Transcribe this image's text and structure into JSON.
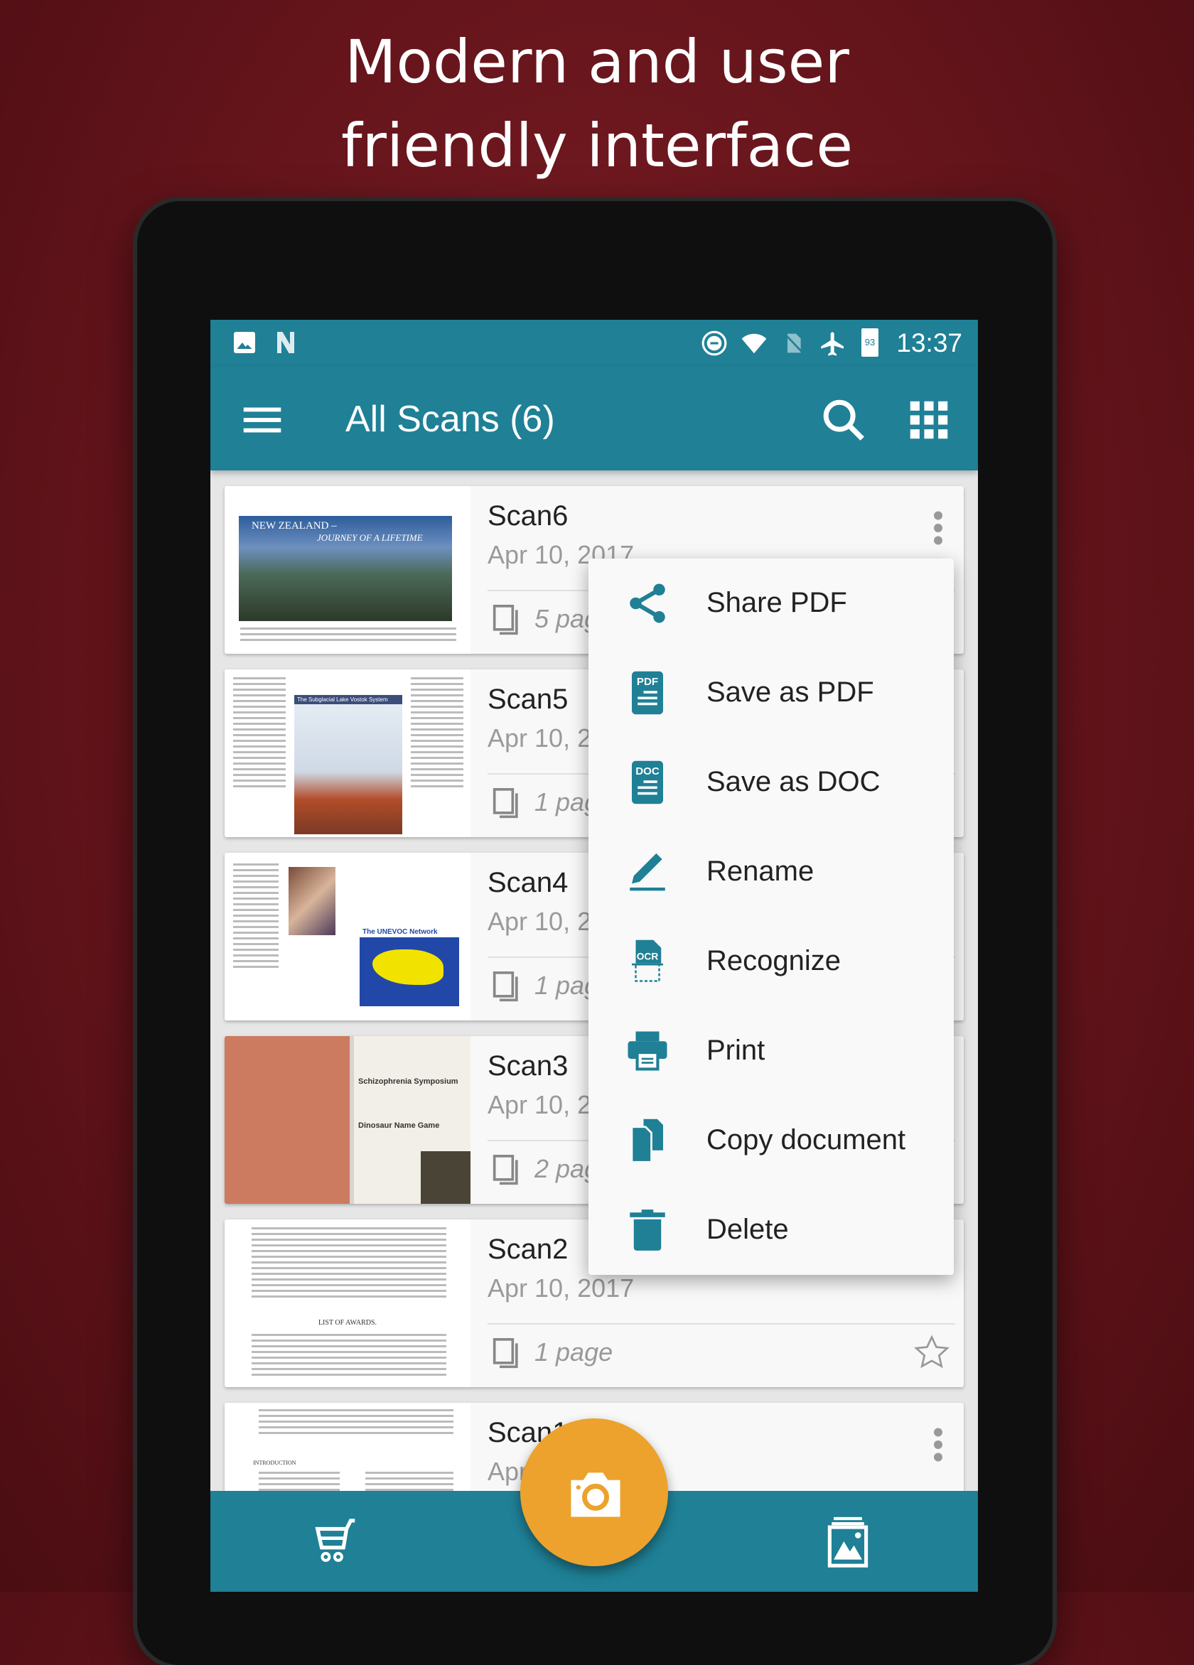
{
  "headline": {
    "line1": "Modern and user",
    "line2": "friendly interface"
  },
  "status_bar": {
    "time": "13:37",
    "battery_level": "93",
    "left_icons": [
      "image-notification-icon",
      "n-notification-icon"
    ],
    "right_icons": [
      "do-not-disturb-icon",
      "wifi-icon",
      "no-sim-icon",
      "airplane-mode-icon",
      "battery-icon"
    ]
  },
  "app_bar": {
    "title": "All Scans (6)",
    "menu_icon": "hamburger-menu-icon",
    "search_icon": "search-icon",
    "grid_icon": "grid-view-icon"
  },
  "scans": [
    {
      "name": "Scan6",
      "date": "Apr 10, 2017",
      "pages": "5 pages",
      "thumb_title": "NEW ZEALAND –",
      "thumb_subtitle": "JOURNEY OF A LIFETIME"
    },
    {
      "name": "Scan5",
      "date": "Apr 10, 2017",
      "pages": "1 page",
      "thumb_title": "The Subglacial Lake Vostok System"
    },
    {
      "name": "Scan4",
      "date": "Apr 10, 2017",
      "pages": "1 page",
      "thumb_title": "The UNEVOC Network"
    },
    {
      "name": "Scan3",
      "date": "Apr 10, 2017",
      "pages": "2 pages",
      "thumb_title": "Schizophrenia Symposium",
      "thumb_subtitle": "Dinosaur Name Game"
    },
    {
      "name": "Scan2",
      "date": "Apr 10, 2017",
      "pages": "1 page",
      "thumb_title": "LIST OF AWARDS."
    },
    {
      "name": "Scan1",
      "date": "Apr 10, 2017",
      "thumb_title": "INTRODUCTION"
    }
  ],
  "context_menu": {
    "items": [
      {
        "label": "Share PDF",
        "icon": "share-icon"
      },
      {
        "label": "Save as PDF",
        "icon": "pdf-file-icon",
        "badge": "PDF"
      },
      {
        "label": "Save as DOC",
        "icon": "doc-file-icon",
        "badge": "DOC"
      },
      {
        "label": "Rename",
        "icon": "pencil-icon"
      },
      {
        "label": "Recognize",
        "icon": "ocr-icon",
        "badge": "OCR"
      },
      {
        "label": "Print",
        "icon": "printer-icon"
      },
      {
        "label": "Copy document",
        "icon": "copy-icon"
      },
      {
        "label": "Delete",
        "icon": "trash-icon"
      }
    ]
  },
  "bottom_bar": {
    "left_icon": "shopping-cart-icon",
    "fab_icon": "camera-icon",
    "right_icon": "gallery-icon"
  },
  "colors": {
    "primary": "#1f8096",
    "accent": "#eca22c",
    "background": "#64141b"
  }
}
